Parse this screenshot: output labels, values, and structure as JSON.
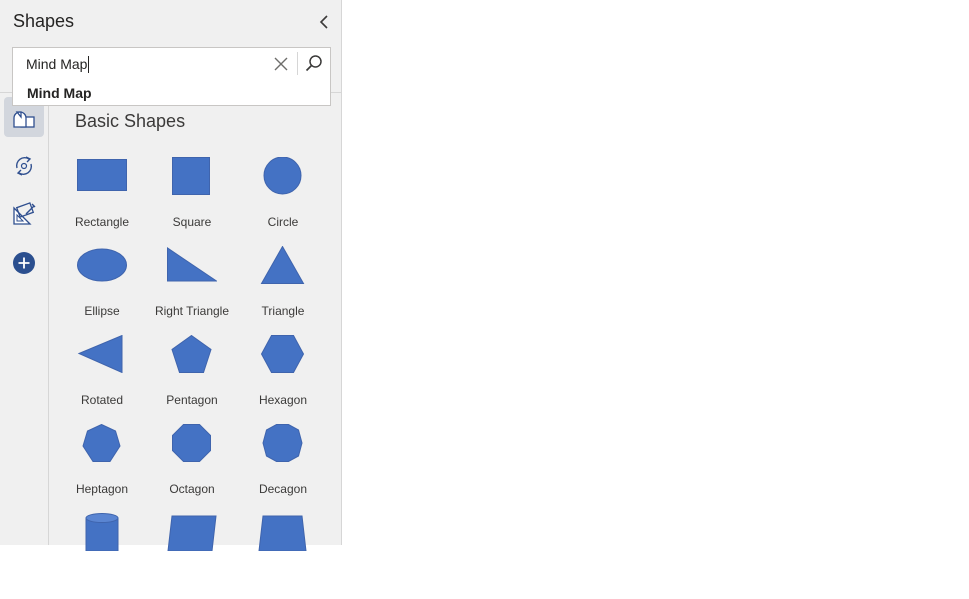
{
  "panel": {
    "title": "Shapes",
    "collapse_icon": "chevron-left-icon"
  },
  "search": {
    "value": "Mind Map",
    "placeholder": "Search",
    "clear_icon": "close-icon",
    "search_icon": "search-icon",
    "suggestion": "Mind Map"
  },
  "rail": [
    {
      "icon": "shapes-icon",
      "selected": true
    },
    {
      "icon": "cycle-icon",
      "selected": false
    },
    {
      "icon": "geometry-tools-icon",
      "selected": false
    },
    {
      "icon": "add-icon",
      "selected": false
    }
  ],
  "stencil": {
    "title": "Basic Shapes",
    "shapes": [
      {
        "label": "Rectangle",
        "icon": "rectangle-shape"
      },
      {
        "label": "Square",
        "icon": "square-shape"
      },
      {
        "label": "Circle",
        "icon": "circle-shape"
      },
      {
        "label": "Ellipse",
        "icon": "ellipse-shape"
      },
      {
        "label": "Right Triangle",
        "icon": "right-triangle-shape"
      },
      {
        "label": "Triangle",
        "icon": "triangle-shape"
      },
      {
        "label": "Rotated",
        "icon": "rotated-triangle-shape"
      },
      {
        "label": "Pentagon",
        "icon": "pentagon-shape"
      },
      {
        "label": "Hexagon",
        "icon": "hexagon-shape"
      },
      {
        "label": "Heptagon",
        "icon": "heptagon-shape"
      },
      {
        "label": "Octagon",
        "icon": "octagon-shape"
      },
      {
        "label": "Decagon",
        "icon": "decagon-shape"
      },
      {
        "label": "",
        "icon": "cylinder-shape"
      },
      {
        "label": "",
        "icon": "parallelogram-shape"
      },
      {
        "label": "",
        "icon": "trapezoid-shape"
      }
    ]
  },
  "colors": {
    "shape_fill": "#4472c4",
    "shape_stroke": "#3f64ad",
    "icon": "#2f4f8f",
    "add": "#2b4f8f"
  }
}
